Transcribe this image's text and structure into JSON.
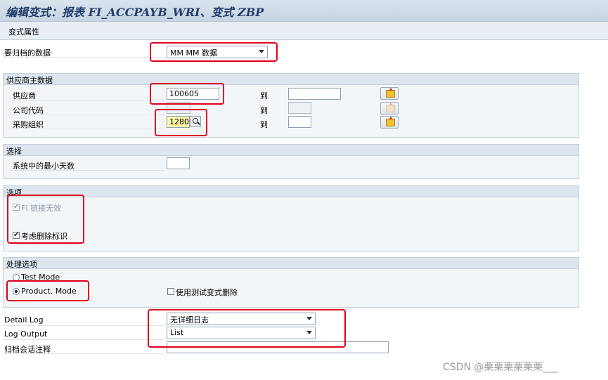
{
  "window": {
    "title": "编辑变式：报表 FI_ACCPAYB_WRI、变式 ZBP"
  },
  "menu": {
    "attributes_label": "变式属性"
  },
  "archive_data": {
    "label": "要归档的数据",
    "value": "MM MM 数据"
  },
  "vendor_section": {
    "title": "供应商主数据",
    "to_label": "到",
    "rows": [
      {
        "label": "供应商",
        "from": "100605",
        "to": ""
      },
      {
        "label": "公司代码",
        "from": "",
        "to": ""
      },
      {
        "label": "采购组织",
        "from": "1280",
        "to": ""
      }
    ]
  },
  "selection_section": {
    "title": "选择",
    "min_days_label": "系统中的最小天数",
    "min_days_value": ""
  },
  "options_section": {
    "title": "选项",
    "fi_link_label": "FI 链接无效",
    "fi_link_checked": true,
    "deletion_flag_label": "考虑删除标识",
    "deletion_flag_checked": true,
    "check_mark": "✔"
  },
  "processing_section": {
    "title": "处理选项",
    "test_mode_label": "Test Mode",
    "product_mode_label": "Product. Mode",
    "selected_mode": "product",
    "test_variant_label": "使用测试变式删除",
    "test_variant_checked": false
  },
  "log": {
    "detail_log_label": "Detail Log",
    "detail_log_value": "无详细日志",
    "log_output_label": "Log Output",
    "log_output_value": "List",
    "session_note_label": "归档会话注释",
    "session_note_value": ""
  },
  "watermark": "CSDN @栗栗栗栗栗栗___",
  "colors": {
    "highlight_box": "#e0001b",
    "title_text": "#203d6a"
  }
}
